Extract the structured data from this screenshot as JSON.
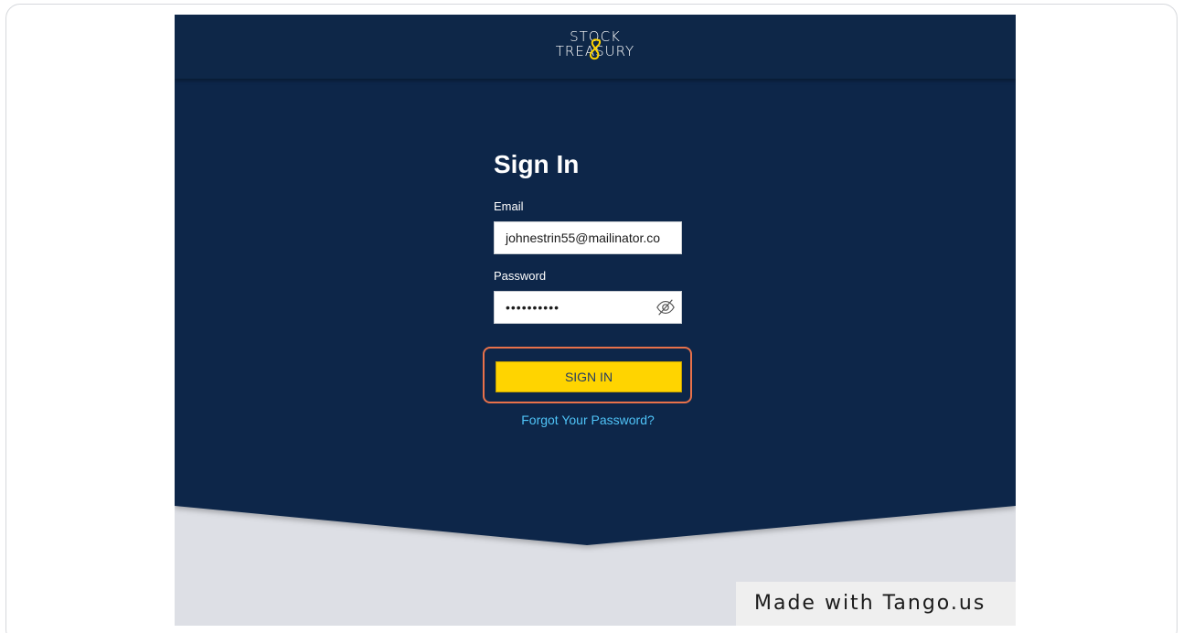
{
  "brand": {
    "logo_line1": "STOCK",
    "logo_line2": "TREASURY"
  },
  "form": {
    "title": "Sign In",
    "email_label": "Email",
    "email_value": "johnestrin55@mailinator.co",
    "password_label": "Password",
    "password_value": "••••••••••",
    "sign_in_label": "SIGN IN",
    "forgot_label": "Forgot Your Password?"
  },
  "watermark": {
    "text": "Made with Tango.us"
  },
  "icons": {
    "password_toggle": "eye-slash-icon",
    "logo_mark": "infinity-s-icon"
  },
  "colors": {
    "navy": "#0e2748",
    "button_yellow": "#ffd400",
    "highlight": "#e8714a",
    "link": "#4fc3f7",
    "below_fold": "#dddfe5"
  }
}
